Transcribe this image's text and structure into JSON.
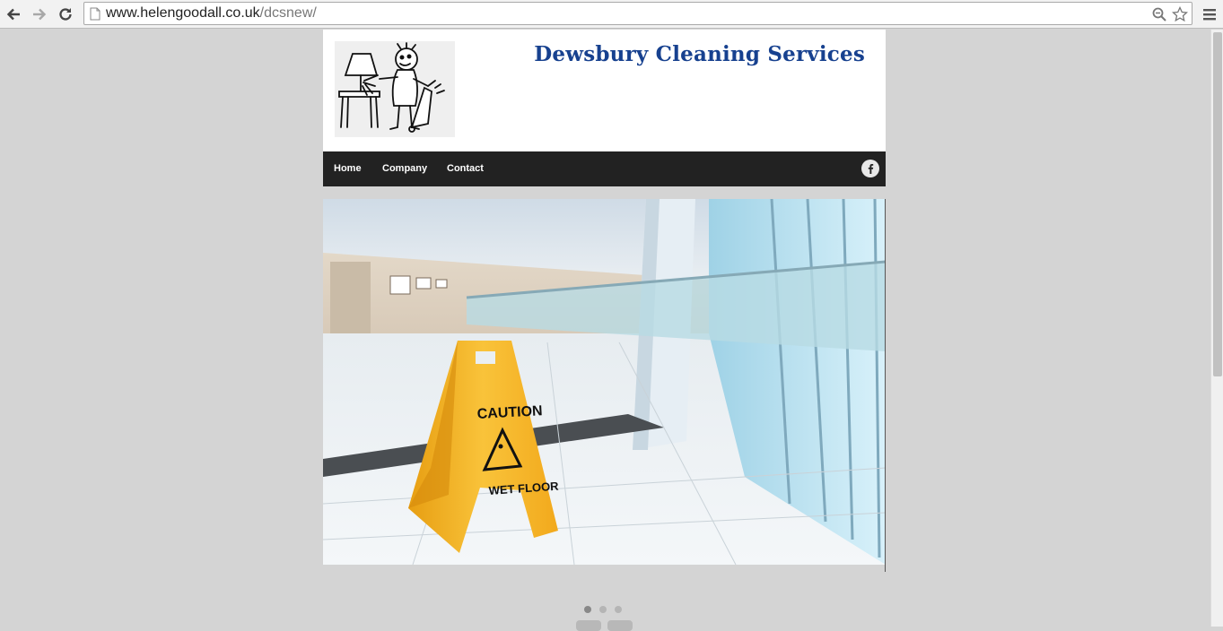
{
  "browser": {
    "url_host": "www.helengoodall.co.uk",
    "url_path": "/dcsnew/"
  },
  "site": {
    "title": "Dewsbury Cleaning Services",
    "nav": [
      {
        "label": "Home"
      },
      {
        "label": "Company"
      },
      {
        "label": "Contact"
      }
    ]
  },
  "hero": {
    "sign_text_1": "CAUTION",
    "sign_text_2": "WET FLOOR"
  },
  "slider": {
    "total_slides": 3,
    "active_slide": 1
  },
  "colors": {
    "title": "#17418f",
    "navbar": "#222222",
    "sign": "#f7b82a",
    "page_bg": "#d4d4d4"
  }
}
